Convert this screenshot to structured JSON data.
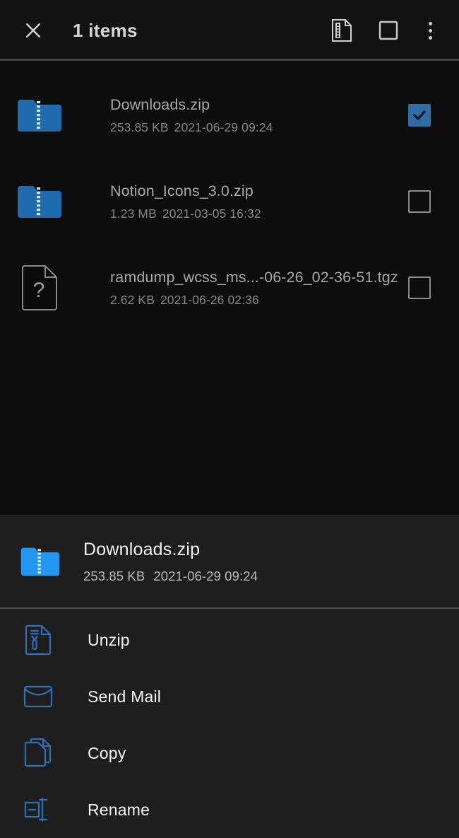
{
  "toolbar": {
    "close_icon": "close-icon",
    "title": "1 items",
    "archive_icon": "archive-file-icon",
    "select_all_icon": "select-all-checkbox-icon",
    "overflow_icon": "more-vertical-icon"
  },
  "colors": {
    "accent_blue": "#2196f3",
    "list_folder_blue": "#1f6bb0",
    "checkbox_checked": "#2f6ca8",
    "action_icon_blue": "#2e6fb5",
    "background": "#0d0d0d",
    "sheet_background": "#1e1e1e",
    "toolbar_background": "#121212"
  },
  "file_list": {
    "items": [
      {
        "name": "Downloads.zip",
        "size": "253.85 KB",
        "date": "2021-06-29 09:24",
        "icon": "zip-folder-icon",
        "selected": true
      },
      {
        "name": "Notion_Icons_3.0.zip",
        "size": "1.23 MB",
        "date": "2021-03-05 16:32",
        "icon": "zip-folder-icon",
        "selected": false
      },
      {
        "name": "ramdump_wcss_ms...-06-26_02-36-51.tgz",
        "size": "2.62 KB",
        "date": "2021-06-26 02:36",
        "icon": "unknown-file-icon",
        "selected": false
      }
    ]
  },
  "sheet": {
    "header": {
      "title": "Downloads.zip",
      "size": "253.85 KB",
      "date": "2021-06-29 09:24",
      "icon": "zip-folder-icon"
    },
    "actions": [
      {
        "label": "Unzip",
        "icon": "unzip-icon"
      },
      {
        "label": "Send Mail",
        "icon": "mail-icon"
      },
      {
        "label": "Copy",
        "icon": "copy-icon"
      },
      {
        "label": "Rename",
        "icon": "rename-icon"
      }
    ]
  }
}
